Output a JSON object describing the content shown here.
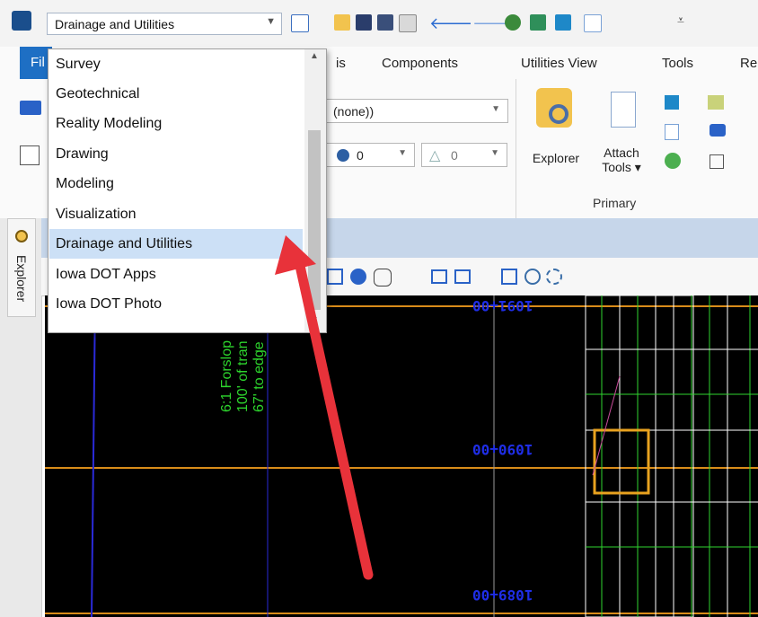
{
  "toolbar": {
    "workflow": "Drainage and Utilities",
    "icons": [
      "app-logo-icon",
      "view-icon",
      "open-folder-icon",
      "save-icon",
      "save-settings-icon",
      "properties-icon",
      "undo-icon",
      "redo-icon",
      "pin-icon",
      "print-icon",
      "window-icon",
      "new-file-icon"
    ]
  },
  "menu": {
    "file": "Fil",
    "tabs": [
      "is",
      "Components",
      "Utilities View",
      "Tools",
      "Re"
    ]
  },
  "ribbon": {
    "level_value": "(none))",
    "color_value": "0",
    "weight_value": "0",
    "explorer_label": "Explorer",
    "attach_label_1": "Attach",
    "attach_label_2": "Tools ▾",
    "group_label": "Primary"
  },
  "dropdown": {
    "items": [
      "Survey",
      "Geotechnical",
      "Reality Modeling",
      "Drawing",
      "Modeling",
      "Visualization",
      "Drainage and Utilities",
      "Iowa DOT Apps",
      "Iowa DOT Photo"
    ],
    "selected_index": 6
  },
  "left_panel": {
    "tab_label": "Explorer"
  },
  "canvas": {
    "stations": [
      "1091+00",
      "1090+00",
      "1089+00"
    ],
    "annotation_lines": [
      "6:1 Forslop",
      "100' of tran",
      "67' to edge"
    ],
    "colors": {
      "background": "#000000",
      "station": "#1f2ee8",
      "annotation": "#2dd42d",
      "arrow": "#e8323a",
      "accent": "#1e6fc4"
    }
  }
}
